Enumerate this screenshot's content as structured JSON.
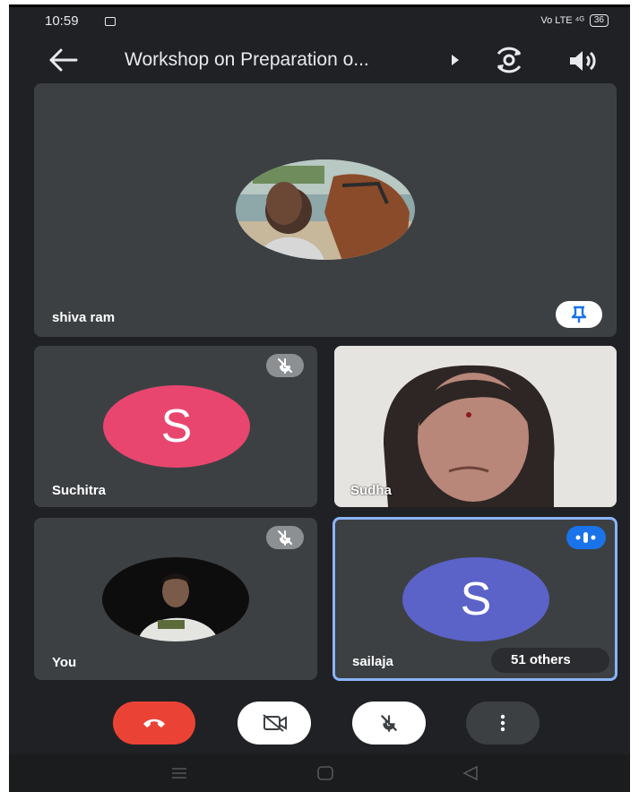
{
  "status_bar": {
    "time": "10:59",
    "signal": "Vo LTE ⁴ᴳ",
    "battery": "36"
  },
  "header": {
    "title": "Workshop on Preparation o..."
  },
  "participants": {
    "main": {
      "name": "shiva ram"
    },
    "p1": {
      "name": "Suchitra",
      "initial": "S"
    },
    "p2": {
      "name": "Sudha"
    },
    "p3": {
      "name": "You"
    },
    "p4": {
      "name": "sailaja",
      "initial": "S"
    }
  },
  "others_chip": "51 others",
  "colors": {
    "background": "#202124",
    "tile": "#3c4043",
    "suchitra_avatar": "#e8466e",
    "sailaja_avatar": "#5b63c8",
    "end_call": "#ea4335",
    "active_speaker_border": "#8ab4f8",
    "pin_blue": "#1a73e8"
  },
  "icons": [
    "back-arrow-icon",
    "play-icon",
    "switch-camera-icon",
    "speaker-icon",
    "pin-icon",
    "mic-off-icon",
    "speaking-icon",
    "end-call-icon",
    "camera-off-icon",
    "more-vert-icon"
  ]
}
